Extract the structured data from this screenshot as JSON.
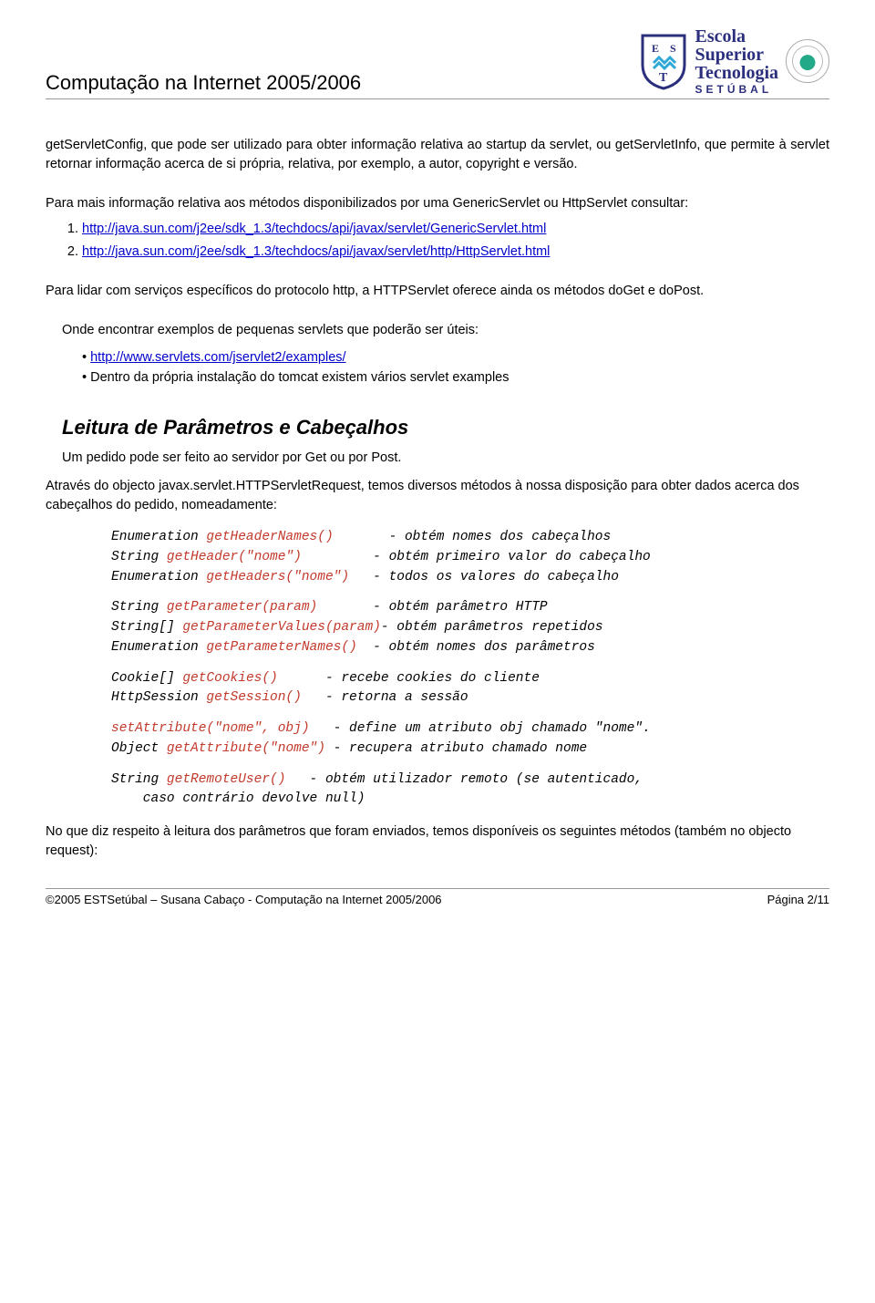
{
  "header": {
    "title": "Computação na Internet 2005/2006",
    "school_l1": "Escola",
    "school_l2": "Superior",
    "school_l3": "Tecnologia",
    "school_l4": "SETÚBAL"
  },
  "para1": "getServletConfig, que pode ser utilizado para obter informação relativa ao startup da servlet, ou getServletInfo, que permite à servlet retornar informação acerca de si própria, relativa, por exemplo, a autor, copyright e versão.",
  "para2_lead": "Para mais informação relativa aos métodos disponibilizados por uma GenericServlet ou HttpServlet consultar:",
  "links1": [
    "http://java.sun.com/j2ee/sdk_1.3/techdocs/api/javax/servlet/GenericServlet.html",
    "http://java.sun.com/j2ee/sdk_1.3/techdocs/api/javax/servlet/http/HttpServlet.html"
  ],
  "para3": "Para lidar com serviços específicos do protocolo http, a HTTPServlet oferece ainda os métodos doGet e doPost.",
  "para4_lead": "Onde encontrar exemplos de pequenas servlets que poderão ser úteis:",
  "bullets1": {
    "link": "http://www.servlets.com/jservlet2/examples/",
    "text": "Dentro da própria instalação do tomcat existem vários servlet examples"
  },
  "section_title": "Leitura de Parâmetros e Cabeçalhos",
  "para5": "Um pedido pode ser feito ao servidor por Get ou por Post.",
  "para6": "Através do objecto javax.servlet.HTTPServletRequest, temos diversos métodos à nossa disposição para obter dados acerca dos cabeçalhos do pedido, nomeadamente:",
  "code": {
    "g1": [
      {
        "sig": "Enumeration ",
        "m": "getHeaderNames()",
        "pad": "       ",
        "c": "- obtém nomes dos cabeçalhos"
      },
      {
        "sig": "String ",
        "m": "getHeader(\"nome\")",
        "pad": "         ",
        "c": "- obtém primeiro valor do cabeçalho"
      },
      {
        "sig": "Enumeration ",
        "m": "getHeaders(\"nome\")",
        "pad": "   ",
        "c": "- todos os valores do cabeçalho"
      }
    ],
    "g2": [
      {
        "sig": "String ",
        "m": "getParameter(param)",
        "pad": "       ",
        "c": "- obtém parâmetro HTTP"
      },
      {
        "sig": "String[] ",
        "m": "getParameterValues(param)",
        "pad": "",
        "c": "- obtém parâmetros repetidos"
      },
      {
        "sig": "Enumeration ",
        "m": "getParameterNames()",
        "pad": "  ",
        "c": "- obtém nomes dos parâmetros"
      }
    ],
    "g3": [
      {
        "sig": "Cookie[] ",
        "m": "getCookies()",
        "pad": "      ",
        "c": "- recebe cookies do cliente"
      },
      {
        "sig": "HttpSession ",
        "m": "getSession()",
        "pad": "   ",
        "c": "- retorna a sessão"
      }
    ],
    "g4": [
      {
        "sig": "",
        "m": "setAttribute(\"nome\", obj)",
        "pad": "   ",
        "c": "- define um atributo obj chamado \"nome\"."
      },
      {
        "sig": "Object ",
        "m": "getAttribute(\"nome\")",
        "pad": " ",
        "c": "- recupera atributo chamado nome"
      }
    ],
    "g5": [
      {
        "sig": "String ",
        "m": "getRemoteUser()",
        "pad": "   ",
        "c": "- obtém utilizador remoto (se autenticado,"
      },
      {
        "sig": "    caso contrário devolve null)",
        "m": "",
        "pad": "",
        "c": ""
      }
    ]
  },
  "para7": "No que diz respeito à leitura dos parâmetros que foram enviados, temos disponíveis os seguintes métodos (também no objecto request):",
  "footer": {
    "left": "©2005 ESTSetúbal – Susana Cabaço - Computação na Internet 2005/2006",
    "right": "Página 2/11"
  }
}
